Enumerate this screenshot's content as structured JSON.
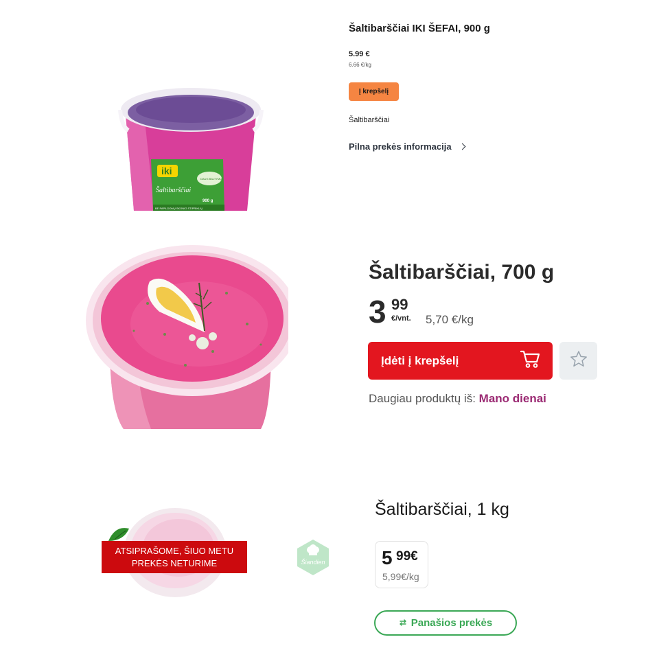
{
  "iki": {
    "title": "Šaltibarščiai IKI ŠEFAI, 900 g",
    "price": "5.99 €",
    "unit_price": "6.66 €/kg",
    "cart_label": "Į krepšelį",
    "category": "Šaltibarščiai",
    "info_link": "Pilna prekės informacija",
    "label_logo": "iki",
    "label_name": "Šaltibarščiai",
    "label_weight": "900 g",
    "label_sticker": "DAUG BALTYMŲ",
    "label_footer": "BE PAPILDOMŲ SKONIO STIPRIKLIŲ",
    "accent": "#f58542"
  },
  "rimi": {
    "title": "Šaltibarščiai, 700 g",
    "price_euros": "3",
    "price_cents": "99",
    "price_per": "€/vnt.",
    "unit_price": "5,70 €/kg",
    "cart_label": "Įdėti į krepšelį",
    "cart_icon": "cart-icon",
    "fav_icon": "star-icon",
    "more_prefix": "Daugiau produktų iš:",
    "more_link": "Mano dienai",
    "accent": "#e3161f",
    "link_color": "#9b2a73"
  },
  "maxima": {
    "title": "Šaltibarščiai, 1 kg",
    "badge_line1": "ATSIPRAŠOME, ŠIUO METU",
    "badge_line2": "PREKĖS NETURIME",
    "today_label": "Šiandien",
    "price_euros": "5",
    "price_cents": "99€",
    "unit_price": "5,99€/kg",
    "similar_icon": "swap-arrows-icon",
    "similar_label": "Panašios prekės",
    "accent": "#3ba856"
  }
}
